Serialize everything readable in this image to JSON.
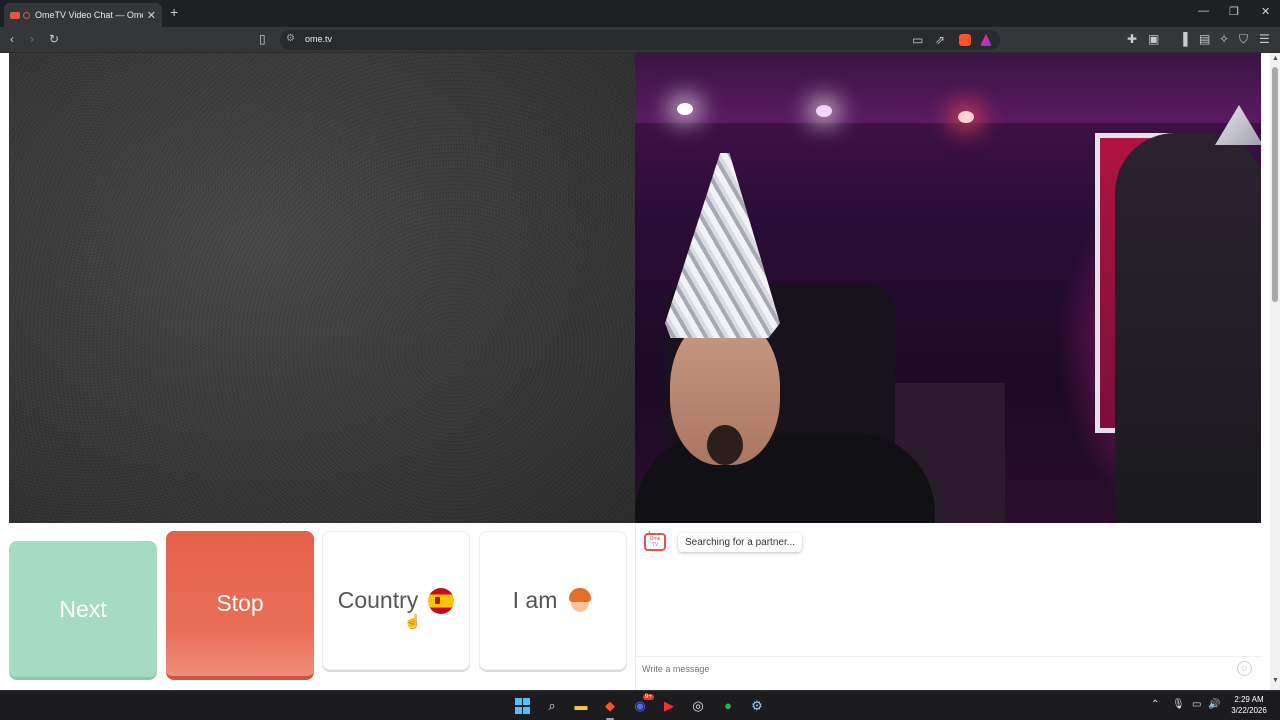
{
  "browser": {
    "tab_title": "OmeTV Video Chat — Omeg",
    "new_tab_symbol": "+",
    "tab_close_symbol": "✕",
    "url": "ome.tv",
    "controls": {
      "minimize": "—",
      "restore": "❐",
      "close": "✕"
    }
  },
  "video": {
    "local_feed": "static-noise",
    "remote_feed": "camera"
  },
  "controls": {
    "next_label": "Next",
    "stop_label": "Stop",
    "country_label": "Country",
    "country_flag": "spain-flag",
    "iam_label": "I am",
    "iam_icon": "boy-avatar-icon"
  },
  "chat": {
    "logo_text": "Ome TV",
    "status_message": "Searching for a partner...",
    "input_placeholder": "Write a message",
    "emoji_icon": "smiley-icon"
  },
  "taskbar": {
    "clock_time": "2:29 AM",
    "clock_date": "3/22/2026",
    "discord_badge": "9+"
  },
  "colors": {
    "next_button": "#a4dbc2",
    "stop_button": "#e56148",
    "chrome_dark": "#35363a",
    "taskbar": "#1c1c1f"
  }
}
